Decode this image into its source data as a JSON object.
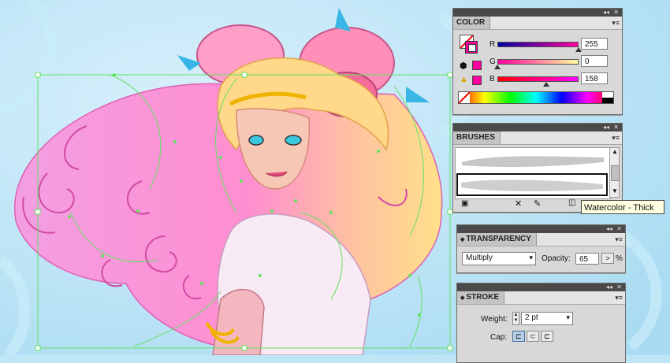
{
  "color_panel": {
    "title": "COLOR",
    "r_label": "R",
    "r_value": "255",
    "g_label": "G",
    "g_value": "0",
    "b_label": "B",
    "b_value": "158",
    "swatch_hex": "#ff009e"
  },
  "brushes_panel": {
    "title": "BRUSHES",
    "tooltip": "Watercolor - Thick"
  },
  "transparency_panel": {
    "title": "TRANSPARENCY",
    "blend_mode": "Multiply",
    "opacity_label": "Opacity:",
    "opacity_value": "65",
    "opacity_unit": "%"
  },
  "stroke_panel": {
    "title": "STROKE",
    "weight_label": "Weight:",
    "weight_value": "2 pt",
    "cap_label": "Cap:"
  },
  "colors": {
    "panel_bg": "#d8d8d8",
    "panel_top": "#4a4a4a",
    "selection": "#5fe35f",
    "hair_pink": "#ff8fcf",
    "hair_blonde": "#ffd07a"
  }
}
